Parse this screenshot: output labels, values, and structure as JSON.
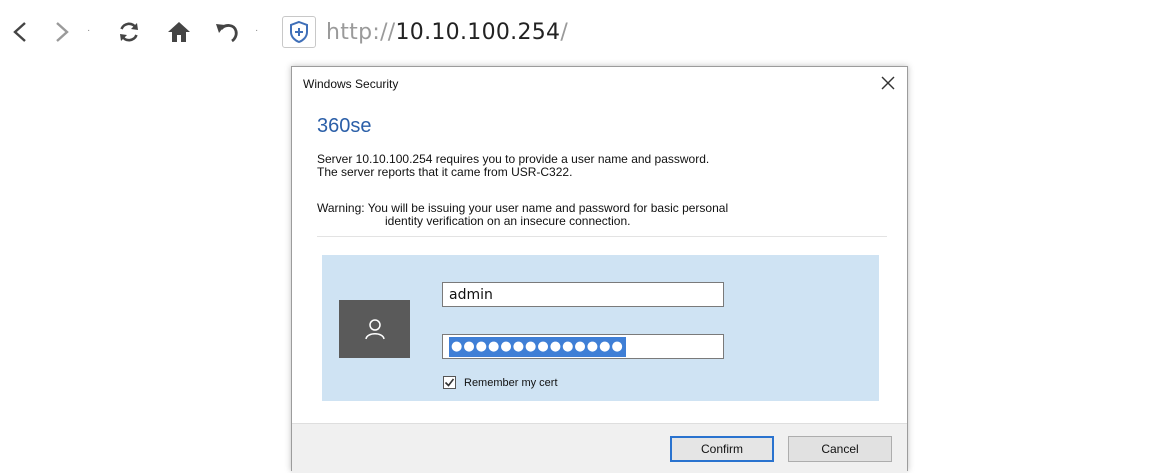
{
  "browser": {
    "icons": {
      "back": "chevron-left-icon",
      "forward": "chevron-right-icon",
      "refresh": "refresh-icon",
      "home": "home-icon",
      "undo": "undo-icon",
      "security": "shield-plus-icon"
    },
    "url": {
      "scheme": "http://",
      "host": "10.10.100.254",
      "tail": "/"
    }
  },
  "dialog": {
    "title": "Windows Security",
    "close": "✕",
    "app_name": "360se",
    "message_line1": "Server 10.10.100.254 requires you to provide a user name and password.",
    "message_line2": "The server reports that it came from USR-C322.",
    "warning_line1": "Warning: You will be issuing your user name and password for basic personal",
    "warning_line2": "identity verification on an insecure connection.",
    "username_value": "admin",
    "password_mask": "●●●●●●●●●●●●●●",
    "remember_label": "Remember my cert",
    "remember_checked": true,
    "confirm_label": "Confirm",
    "cancel_label": "Cancel",
    "accent_color": "#2a73cf",
    "panel_color": "#cfe3f3"
  }
}
